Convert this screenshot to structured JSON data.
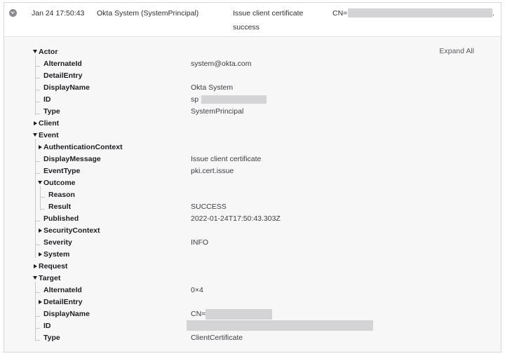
{
  "summary": {
    "time": "Jan 24 17:50:43",
    "actor": "Okta System (SystemPrincipal)",
    "event_line1": "Issue client certificate",
    "event_line2": "success",
    "target_prefix": "CN=",
    "target_suffix": "."
  },
  "details": {
    "expand_all": "Expand All",
    "actor": {
      "label": "Actor",
      "alternate_id_key": "AlternateId",
      "alternate_id_val": "system@okta.com",
      "detail_entry_key": "DetailEntry",
      "display_name_key": "DisplayName",
      "display_name_val": "Okta System",
      "id_key": "ID",
      "id_val": "sp",
      "type_key": "Type",
      "type_val": "SystemPrincipal"
    },
    "client": {
      "label": "Client"
    },
    "event": {
      "label": "Event",
      "auth_ctx_key": "AuthenticationContext",
      "display_message_key": "DisplayMessage",
      "display_message_val": "Issue client certificate",
      "event_type_key": "EventType",
      "event_type_val": "pki.cert.issue",
      "outcome_key": "Outcome",
      "reason_key": "Reason",
      "result_key": "Result",
      "result_val": "SUCCESS",
      "published_key": "Published",
      "published_val": "2022-01-24T17:50:43.303Z",
      "security_ctx_key": "SecurityContext",
      "severity_key": "Severity",
      "severity_val": "INFO",
      "system_key": "System"
    },
    "request": {
      "label": "Request"
    },
    "target": {
      "label": "Target",
      "alternate_id_key": "AlternateId",
      "alternate_id_val": "0×4",
      "detail_entry_key": "DetailEntry",
      "display_name_key": "DisplayName",
      "display_name_val": "CN=",
      "id_key": "ID",
      "type_key": "Type",
      "type_val": "ClientCertificate"
    }
  },
  "colors": {
    "panel_bg": "#f7f7f8",
    "border": "#d7d7dc",
    "tree_line": "#c8c8cc",
    "redaction": "#d4d4d6"
  }
}
